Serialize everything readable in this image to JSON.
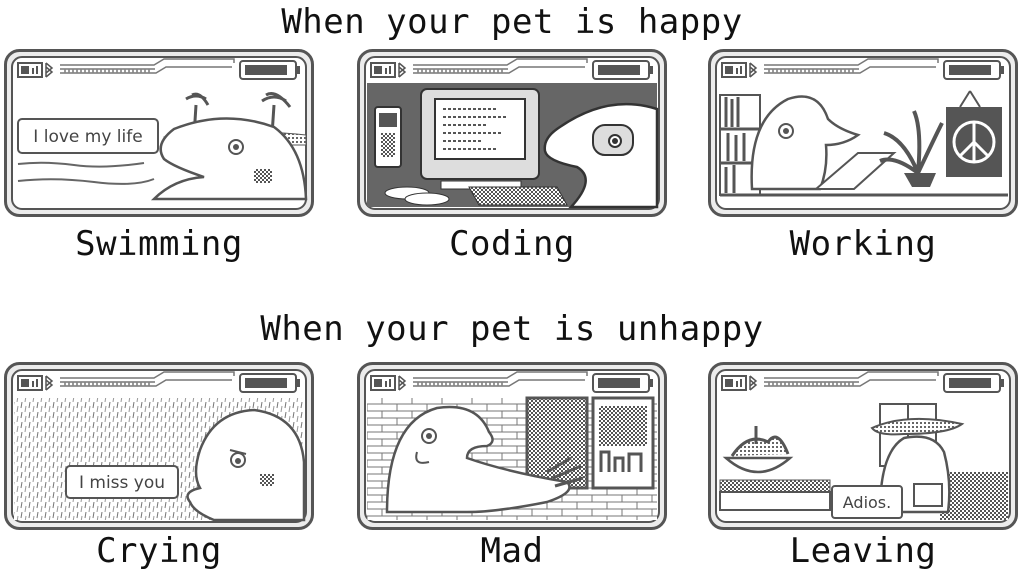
{
  "headings": {
    "happy": "When your pet is happy",
    "unhappy": "When your pet is unhappy"
  },
  "happy_cards": [
    {
      "caption": "Swimming",
      "bubble": "I love my life",
      "icons": [
        "battery-icon",
        "bluetooth-icon",
        "signal-icon"
      ]
    },
    {
      "caption": "Coding",
      "bubble": "",
      "icons": [
        "battery-icon",
        "bluetooth-icon",
        "signal-icon"
      ]
    },
    {
      "caption": "Working",
      "bubble": "",
      "icons": [
        "battery-icon",
        "bluetooth-icon",
        "signal-icon"
      ]
    }
  ],
  "unhappy_cards": [
    {
      "caption": "Crying",
      "bubble": "I miss you",
      "icons": [
        "battery-icon",
        "bluetooth-icon",
        "signal-icon"
      ]
    },
    {
      "caption": "Mad",
      "bubble": "",
      "icons": [
        "battery-icon",
        "bluetooth-icon",
        "signal-icon"
      ]
    },
    {
      "caption": "Leaving",
      "bubble": "Adios.",
      "icons": [
        "battery-icon",
        "bluetooth-icon",
        "signal-icon"
      ]
    }
  ],
  "colors": {
    "ink": "#555555",
    "screen": "#ffffff",
    "frame": "#e9e9e9"
  }
}
